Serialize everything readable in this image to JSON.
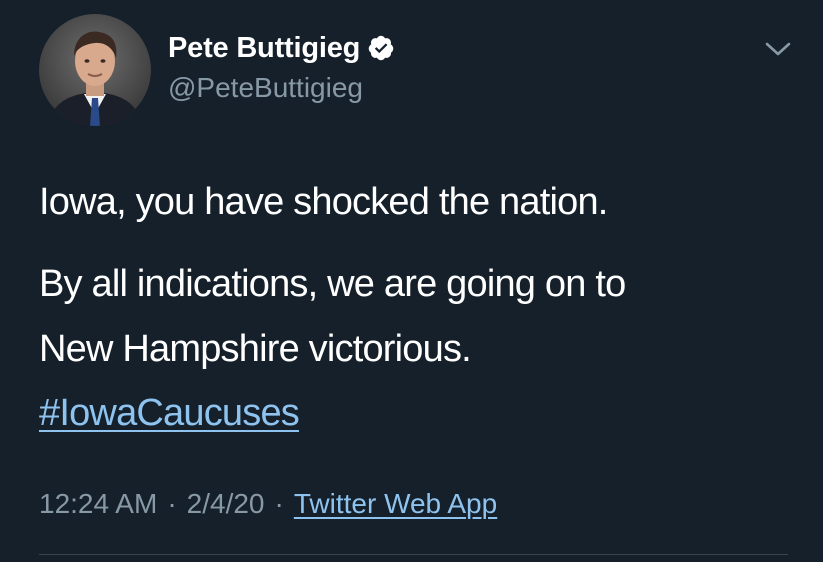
{
  "tweet": {
    "author": {
      "display_name": "Pete Buttigieg",
      "handle": "@PeteButtigieg",
      "verified": true
    },
    "text_lines": [
      "Iowa, you have shocked the nation.",
      "By all indications, we are going on to",
      "New Hampshire victorious."
    ],
    "hashtag": "#IowaCaucuses",
    "time": "12:24 AM",
    "separator": "·",
    "date": "2/4/20",
    "source": "Twitter Web App"
  },
  "icons": {
    "avatar": "profile-photo",
    "verified": "verified-badge-icon",
    "menu": "chevron-down-icon"
  },
  "colors": {
    "background": "#15202b",
    "text": "#ffffff",
    "secondary": "#8899a6",
    "link": "#8ec3ef",
    "divider": "#38444d"
  }
}
